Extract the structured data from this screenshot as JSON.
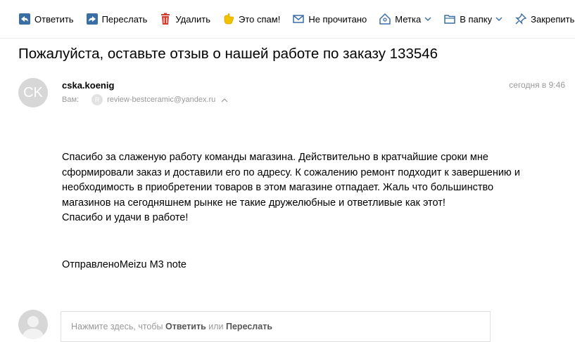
{
  "toolbar": {
    "reply": "Ответить",
    "forward": "Переслать",
    "delete": "Удалить",
    "spam": "Это спам!",
    "unread": "Не прочитано",
    "label": "Метка",
    "folder": "В папку",
    "pin": "Закрепить"
  },
  "message": {
    "subject": "Пожалуйста, оставьте отзыв о нашей работе по заказу 133546",
    "avatar_initials": "CK",
    "sender": "cska.koenig",
    "date": "сегодня в 9:46",
    "to_label": "Вам:",
    "to_avatar": "R",
    "to_address": "review-bestceramic@yandex.ru",
    "body_lines": [
      "Спасибо за слаженую работу команды магазина. Действительно в кратчайшие сроки мне",
      "сформировали заказ и доставили его по адресу. К сожалению ремонт подходит к завершению и",
      "необходимость в приобретении товаров в этом магазине отпадает. Жаль что большинство",
      "магазинов на сегодняшнем рынке не такие дружелюбные и ответливые как этот!",
      "Спасибо и удачи в работе!"
    ],
    "signature": "ОтправленоMeizu M3 note"
  },
  "quick_reply": {
    "prefix": "Нажмите здесь, чтобы ",
    "reply": "Ответить",
    "or": " или ",
    "forward": "Переслать"
  },
  "colors": {
    "icon_blue": "#3a6ea5",
    "delete_red": "#d63a2f",
    "spam_yellow": "#f2c200",
    "muted": "#999999"
  }
}
